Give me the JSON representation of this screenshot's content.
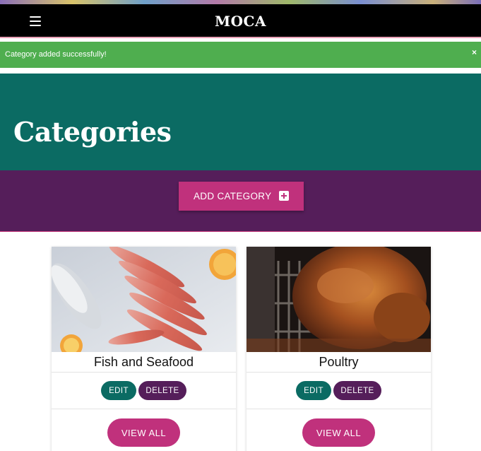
{
  "navbar": {
    "brand": "MOCA",
    "menu_icon": "hamburger-menu-icon"
  },
  "alert": {
    "message": "Category added successfully!",
    "close_label": "×"
  },
  "hero": {
    "title": "Categories"
  },
  "actions": {
    "add_label": "ADD CATEGORY",
    "add_icon": "plus-square-icon"
  },
  "categories": [
    {
      "name": "Fish and Seafood",
      "edit_label": "EDIT",
      "delete_label": "DELETE",
      "view_label": "VIEW ALL"
    },
    {
      "name": "Poultry",
      "edit_label": "EDIT",
      "delete_label": "DELETE",
      "view_label": "VIEW ALL"
    }
  ],
  "colors": {
    "navbar": "#000000",
    "alert": "#4fae4f",
    "hero": "#0b6b63",
    "action_bar": "#551e5a",
    "accent": "#c0317c",
    "edit": "#0b6b63",
    "delete": "#551e5a"
  }
}
